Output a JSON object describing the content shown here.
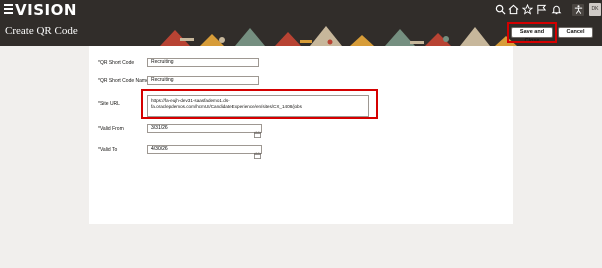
{
  "app": {
    "logo": "VISION"
  },
  "topbar": {
    "avatar_initials": "DK",
    "icons": [
      "search-icon",
      "home-icon",
      "star-icon",
      "flag-icon",
      "bell-icon",
      "accessibility-icon"
    ]
  },
  "page": {
    "title": "Create QR Code"
  },
  "actions": {
    "save_close": "Save and Close",
    "cancel": "Cancel"
  },
  "form": {
    "short_code": {
      "label": "*QR Short Code",
      "value": "Recruiting"
    },
    "short_code_name": {
      "label": "*QR Short Code Name",
      "value": "Recruiting"
    },
    "site_url": {
      "label": "*Site URL",
      "line1": "https://fa-eujh-dev31-saasfademo1.ds-",
      "line2": "fa.oraclepdemos.com/hcmUI/CandidateExperience/en/sites/CX_1408/jobs"
    },
    "valid_from": {
      "label": "*Valid From",
      "value": "3/31/26"
    },
    "valid_to": {
      "label": "*Valid To",
      "value": "4/30/26"
    }
  },
  "colors": {
    "bar": "#312d2a",
    "highlight": "#d50000",
    "canvas": "#f1efed"
  }
}
